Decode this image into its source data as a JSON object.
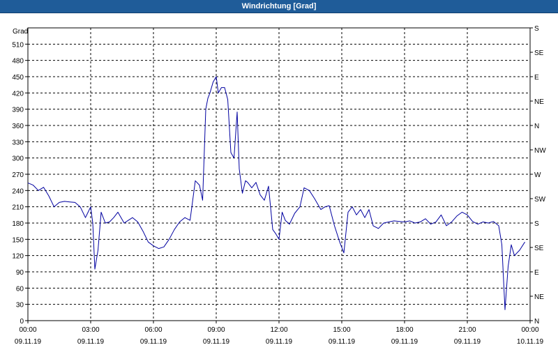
{
  "window": {
    "title": "Windrichtung [Grad]"
  },
  "colors": {
    "titlebar": "#1f5c99",
    "line": "#0000a0",
    "grid": "#000000"
  },
  "chart_data": {
    "type": "line",
    "title": "Windrichtung [Grad]",
    "ylabel": "Grad",
    "xlabel": "",
    "ylim": [
      0,
      540
    ],
    "y_ticks": [
      0,
      30,
      60,
      90,
      120,
      150,
      180,
      210,
      240,
      270,
      300,
      330,
      360,
      390,
      420,
      450,
      480,
      510
    ],
    "right_axis_labels": [
      "N",
      "NE",
      "E",
      "SE",
      "S",
      "SW",
      "W",
      "NW",
      "N",
      "NE",
      "E",
      "SE",
      "S"
    ],
    "x_ticks": [
      {
        "time": "00:00",
        "date": "09.11.19"
      },
      {
        "time": "03:00",
        "date": "09.11.19"
      },
      {
        "time": "06:00",
        "date": "09.11.19"
      },
      {
        "time": "09:00",
        "date": "09.11.19"
      },
      {
        "time": "12:00",
        "date": "09.11.19"
      },
      {
        "time": "15:00",
        "date": "09.11.19"
      },
      {
        "time": "18:00",
        "date": "09.11.19"
      },
      {
        "time": "21:00",
        "date": "09.11.19"
      },
      {
        "time": "00:00",
        "date": "10.11.19"
      }
    ],
    "grid": true,
    "series": [
      {
        "name": "",
        "x_hours": [
          0,
          0.25,
          0.5,
          0.75,
          1.0,
          1.25,
          1.5,
          1.75,
          2.0,
          2.25,
          2.5,
          2.75,
          3.0,
          3.1,
          3.2,
          3.35,
          3.5,
          3.7,
          3.9,
          4.1,
          4.3,
          4.6,
          4.8,
          5.0,
          5.25,
          5.5,
          5.75,
          6.0,
          6.25,
          6.5,
          6.75,
          7.0,
          7.25,
          7.5,
          7.75,
          8.0,
          8.2,
          8.35,
          8.5,
          8.6,
          8.7,
          8.85,
          9.0,
          9.1,
          9.25,
          9.4,
          9.55,
          9.7,
          9.85,
          10.0,
          10.1,
          10.25,
          10.4,
          10.5,
          10.7,
          10.9,
          11.1,
          11.3,
          11.5,
          11.7,
          11.85,
          12.0,
          12.15,
          12.3,
          12.5,
          12.75,
          13.0,
          13.2,
          13.45,
          13.7,
          14.0,
          14.2,
          14.4,
          14.65,
          14.9,
          15.1,
          15.3,
          15.5,
          15.7,
          15.9,
          16.1,
          16.3,
          16.5,
          16.75,
          17.0,
          17.25,
          17.5,
          17.75,
          18.0,
          18.25,
          18.5,
          18.75,
          19.0,
          19.25,
          19.5,
          19.75,
          20.0,
          20.25,
          20.5,
          20.75,
          21.0,
          21.25,
          21.5,
          21.75,
          22.0,
          22.25,
          22.5,
          22.65,
          22.8,
          22.95,
          23.1,
          23.25,
          23.5,
          23.75
        ],
        "values": [
          254,
          250,
          240,
          246,
          230,
          210,
          218,
          220,
          219,
          218,
          210,
          190,
          210,
          180,
          95,
          130,
          200,
          180,
          182,
          190,
          200,
          180,
          185,
          190,
          182,
          165,
          145,
          138,
          133,
          136,
          150,
          168,
          182,
          190,
          185,
          258,
          250,
          222,
          390,
          410,
          420,
          440,
          450,
          420,
          430,
          430,
          408,
          310,
          300,
          385,
          280,
          235,
          258,
          255,
          245,
          255,
          232,
          222,
          248,
          168,
          160,
          150,
          200,
          185,
          178,
          198,
          210,
          245,
          240,
          225,
          205,
          210,
          212,
          175,
          145,
          125,
          200,
          210,
          195,
          205,
          190,
          205,
          175,
          170,
          180,
          182,
          184,
          183,
          182,
          184,
          180,
          182,
          188,
          178,
          182,
          195,
          175,
          182,
          193,
          200,
          195,
          183,
          178,
          182,
          180,
          183,
          175,
          140,
          20,
          100,
          140,
          120,
          130,
          145
        ]
      }
    ]
  }
}
